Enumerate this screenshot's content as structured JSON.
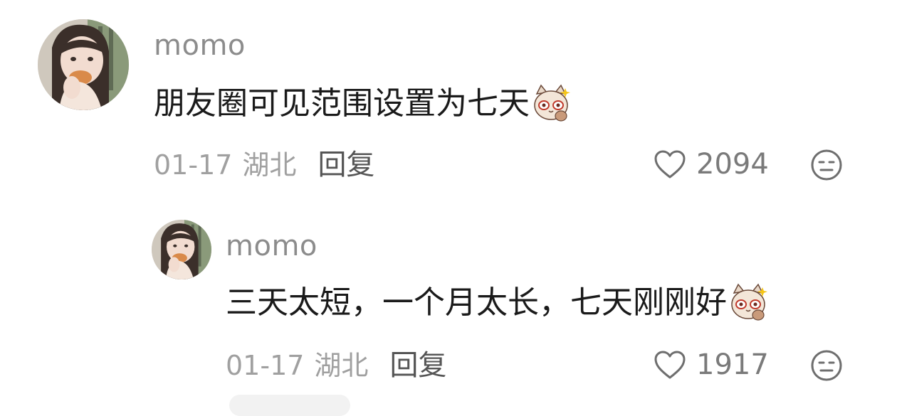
{
  "comments": [
    {
      "username": "momo",
      "text": "朋友圈可见范围设置为七天",
      "emoji": "cat-glasses-emoji",
      "date": "01-17",
      "location": "湖北",
      "reply_label": "回复",
      "likes": "2094",
      "like_icon": "heart-outline-icon",
      "dislike_icon": "meh-face-icon"
    },
    {
      "username": "momo",
      "text": "三天太短，一个月太长，七天刚刚好",
      "emoji": "cat-glasses-emoji",
      "date": "01-17",
      "location": "湖北",
      "reply_label": "回复",
      "likes": "1917",
      "like_icon": "heart-outline-icon",
      "dislike_icon": "meh-face-icon"
    }
  ],
  "colors": {
    "username": "#8c8c8c",
    "meta": "#a0a0a0",
    "reply": "#555555",
    "text": "#1a1a1a",
    "icon": "#6e6e6e"
  }
}
